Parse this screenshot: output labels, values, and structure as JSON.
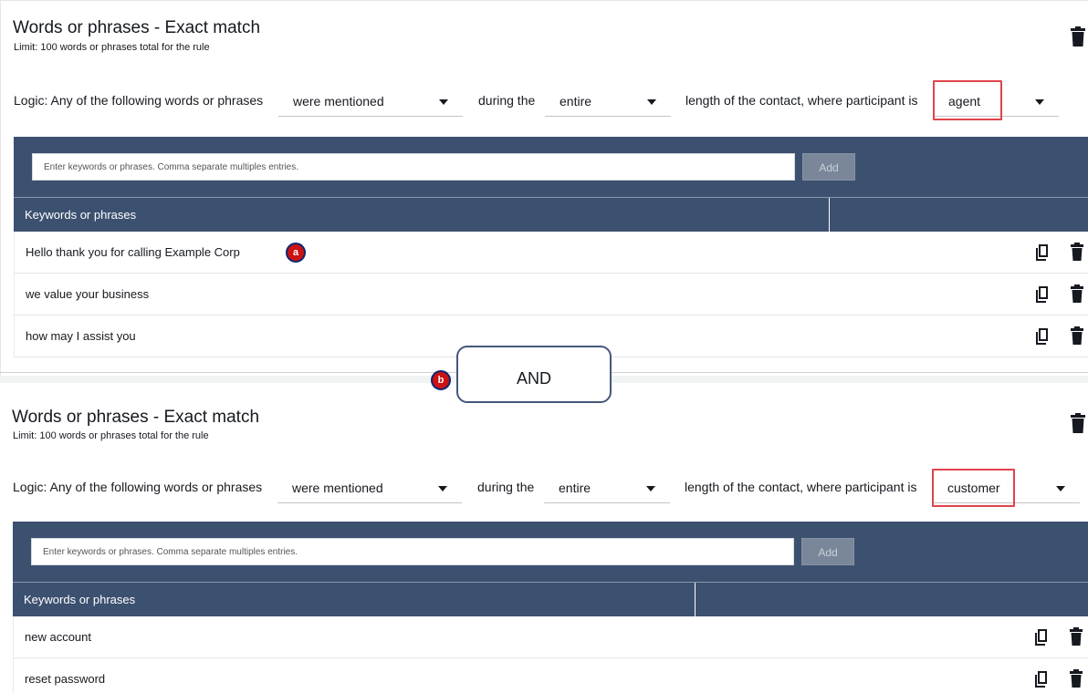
{
  "sections": [
    {
      "title": "Words or phrases - Exact match",
      "limit": "Limit: 100 words or phrases total for the rule",
      "logic_prefix": "Logic: Any of the following words or phrases",
      "mention_value": "were mentioned",
      "during_text": "during the",
      "period_value": "entire",
      "length_text": "length of the contact, where participant is",
      "participant_value": "agent",
      "input_placeholder": "Enter keywords or phrases. Comma separate multiples entries.",
      "add_label": "Add",
      "column_header": "Keywords or phrases",
      "keywords": [
        "Hello thank you for calling Example Corp",
        "we value your business",
        "how may I assist you"
      ]
    },
    {
      "title": "Words or phrases - Exact match",
      "limit": "Limit: 100 words or phrases total for the rule",
      "logic_prefix": "Logic: Any of the following words or phrases",
      "mention_value": "were mentioned",
      "during_text": "during the",
      "period_value": "entire",
      "length_text": "length of the contact, where participant is",
      "participant_value": "customer",
      "input_placeholder": "Enter keywords or phrases. Comma separate multiples entries.",
      "add_label": "Add",
      "column_header": "Keywords or phrases",
      "keywords": [
        "new account",
        "reset password"
      ]
    }
  ],
  "operator_label": "AND",
  "callouts": {
    "a": "a",
    "b": "b"
  },
  "colors": {
    "panel": "#3c5070",
    "highlight": "#e0434b",
    "callout": "#cc1212"
  },
  "icons": {
    "copy": "copy-icon",
    "delete": "trash-icon"
  }
}
